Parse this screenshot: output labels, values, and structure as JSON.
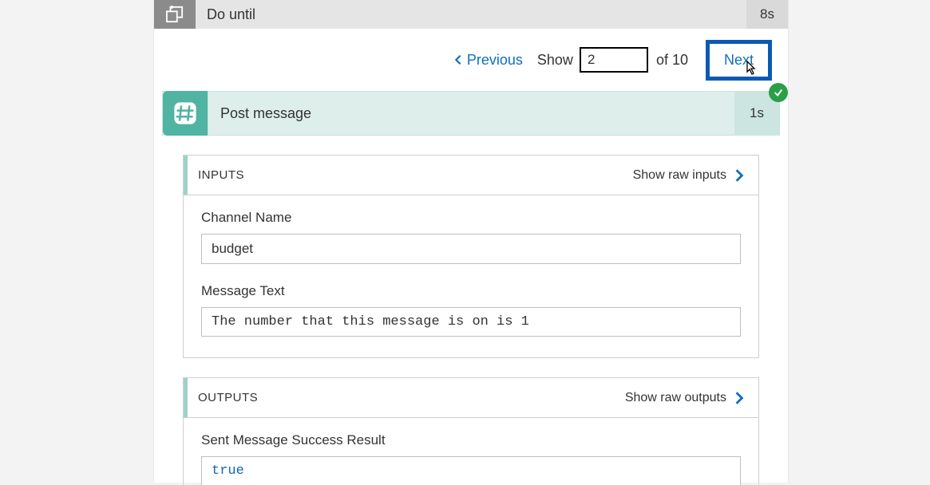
{
  "header": {
    "title": "Do until",
    "duration": "8s"
  },
  "nav": {
    "previous_label": "Previous",
    "show_label": "Show",
    "show_value": "2",
    "of_label": "of 10",
    "next_label": "Next"
  },
  "action": {
    "title": "Post message",
    "duration": "1s",
    "status": "success"
  },
  "inputs": {
    "section_title": "INPUTS",
    "raw_link": "Show raw inputs",
    "fields": {
      "channel_name": {
        "label": "Channel Name",
        "value": "budget"
      },
      "message_text": {
        "label": "Message Text",
        "value": "The number that this message is on is 1"
      }
    }
  },
  "outputs": {
    "section_title": "OUTPUTS",
    "raw_link": "Show raw outputs",
    "fields": {
      "sent_success": {
        "label": "Sent Message Success Result",
        "value": "true"
      }
    }
  }
}
